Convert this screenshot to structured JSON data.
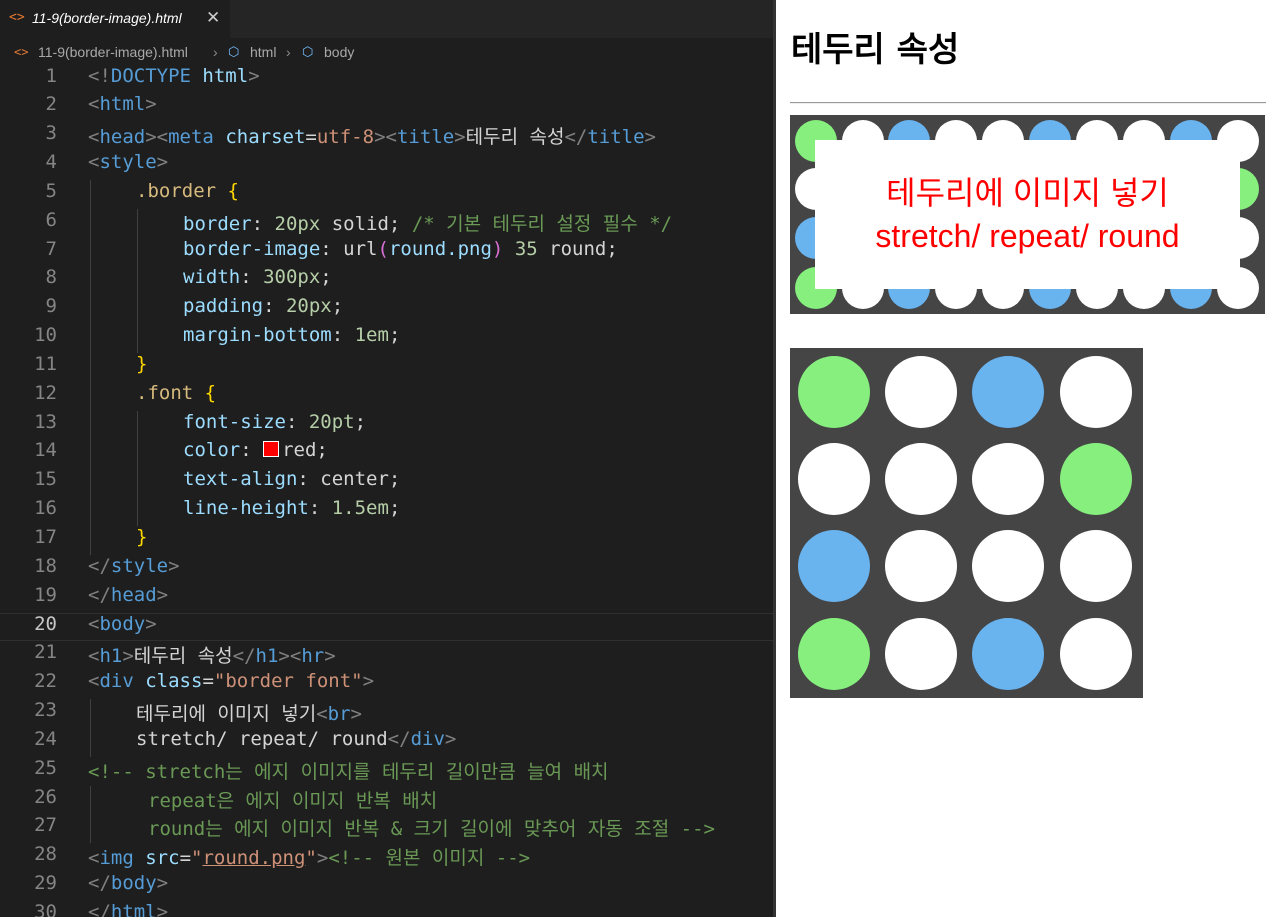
{
  "editor": {
    "tab": {
      "icon": "html-file-icon",
      "label": "11-9(border-image).html",
      "close": "✕"
    },
    "breadcrumb": {
      "file": "11-9(border-image).html",
      "html": "html",
      "body": "body"
    },
    "current_line": 20,
    "line_numbers": [
      "1",
      "2",
      "3",
      "4",
      "5",
      "6",
      "7",
      "8",
      "9",
      "10",
      "11",
      "12",
      "13",
      "14",
      "15",
      "16",
      "17",
      "18",
      "19",
      "20",
      "21",
      "22",
      "23",
      "24",
      "25",
      "26",
      "27",
      "28",
      "29",
      "30"
    ],
    "code": {
      "l1_a": "<!",
      "l1_b": "DOCTYPE",
      "l1_c": " ",
      "l1_d": "html",
      "l1_e": ">",
      "l3_text": "테두리 속성",
      "l5": ".border",
      "l6_prop": "border",
      "l6_num": "20px",
      "l6_val": " solid;",
      "l6_com": " /* 기본 테두리 설정 필수 */",
      "l7_prop": "border-image",
      "l7_fn": "url",
      "l7_arg": "round.png",
      "l7_num": "35",
      "l7_val": " round;",
      "l8_prop": "width",
      "l8_num": "300px",
      "l9_prop": "padding",
      "l9_num": "20px",
      "l10_prop": "margin-bottom",
      "l10_num": "1em",
      "l12": ".font",
      "l13_prop": "font-size",
      "l13_num": "20pt",
      "l14_prop": "color",
      "l14_val": "red;",
      "l15_prop": "text-align",
      "l15_val": " center;",
      "l16_prop": "line-height",
      "l16_num": "1.5em",
      "l21_text": "테두리 속성",
      "l22_attr": "class",
      "l22_str": "\"border font\"",
      "l23_text": "테두리에 이미지 넣기",
      "l24_text": "stretch/ repeat/ round",
      "l25": "<!-- stretch는 에지 이미지를 테두리 길이만큼 늘여 배치",
      "l26": "repeat은 에지 이미지 반복 배치",
      "l27": "round는 에지 이미지 반복 & 크기 길이에 맞추어 자동 조절 -->",
      "l28_attr": "src",
      "l28_q1": "\"",
      "l28_link": "round.png",
      "l28_q2": "\"",
      "l28_com": "<!-- 원본 이미지 -->"
    }
  },
  "preview": {
    "heading": "테두리 속성",
    "box_line1": "테두리에 이미지 넣기",
    "box_line2": "stretch/ repeat/ round",
    "text_color": "#ff0000",
    "image_alt": "round.png",
    "image_grid": [
      [
        "green",
        "white",
        "blue",
        "white"
      ],
      [
        "white",
        "white",
        "white",
        "green"
      ],
      [
        "blue",
        "white",
        "white",
        "white"
      ],
      [
        "green",
        "white",
        "blue",
        "white"
      ]
    ]
  },
  "colors": {
    "green": "#86ef7e",
    "white": "#ffffff",
    "blue": "#69b3ef",
    "border_bg": "#454545"
  }
}
